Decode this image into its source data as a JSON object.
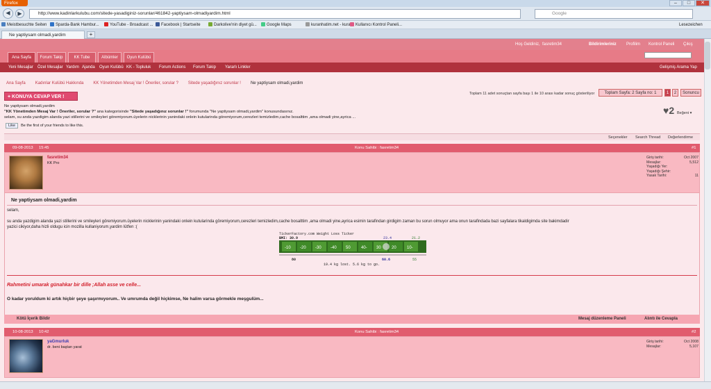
{
  "browser": {
    "app_button": "Firefox",
    "url": "http://www.kadinlarkulubu.com/sitede-yasadiginiz-sorunlar/461842-yaptiysam-olmadiyardim.html",
    "search_placeholder": "Google",
    "bookmarks_label": "Lesezeichen",
    "tab_title": "Ne yaptiysam olmadi,yardim",
    "new_tab": "+",
    "back": "◀",
    "forward": "▶",
    "min": "–",
    "max": "□",
    "close": "✕",
    "bookmarks": [
      {
        "label": "Meistbesuchte Seiten",
        "color": "#4a7fc0"
      },
      {
        "label": "Sparda-Bank Hambur...",
        "color": "#2f73c7"
      },
      {
        "label": "YouTube - Broadcast ...",
        "color": "#d22"
      },
      {
        "label": "Facebook | Startseite",
        "color": "#3b5998"
      },
      {
        "label": "Darkolive'nin diyet gü...",
        "color": "#7a3"
      },
      {
        "label": "Google Maps",
        "color": "#4c8"
      },
      {
        "label": "kuranhatim.net - kura...",
        "color": "#999"
      },
      {
        "label": "Kullanıcı Kontrol Paneli...",
        "color": "#e05a86"
      }
    ]
  },
  "site": {
    "top_links": {
      "welcome": "Hoş Geldiniz, ",
      "user": "fasretim34",
      "notifications": "Bildirimleriniz",
      "profile": "Profilim",
      "control_panel": "Kontrol Paneli",
      "logout": "Çıkış"
    },
    "main_tabs": [
      "Ana Sayfa",
      "Forum Takip",
      "KK Tube",
      "Albümler",
      "Oyun Kulübü"
    ],
    "sub_nav": [
      "Yeni Mesajlar",
      "Özel Mesajlar",
      "Yardım",
      "Ajanda",
      "Oyun Kulübü",
      "KK - Topluluk",
      "Forum Actions",
      "Forum Takip",
      "Yararlı Linkler"
    ],
    "advanced_search": "Gelişmiş Arama Yap",
    "breadcrumb": [
      "Ana Sayfa",
      "Kadınlar Kulübü Hakkında",
      "KK Yönetimden Mesaj Var ! Öneriler, sorular ?",
      "Sitede yaşadığınız sorunlar !",
      "Ne yaptiysam olmadi,yardim"
    ],
    "reply_button": "+ KONUYA CEVAP VER !",
    "page_info": "Toplam 11 adet sonuçtan sayfa başı 1 ile 10 arası kadar sonuç gösteriliyor",
    "pager": {
      "summary": "Toplam Sayfa: 2 Sayfa no: 1",
      "pages": [
        "1",
        "2"
      ],
      "last": "Sonuncu"
    },
    "intro": {
      "line1": "Ne yaptiysam olmadi,yardim",
      "cat1": "\"KK Yönetimden Mesaj Var ! Öneriler, sorular ?\"",
      "mid1": " ana kategorisinde ",
      "cat2": "\"Sitede yaşadığınız sorunlar !\"",
      "mid2": " forumunda \"Ne yaptiysam olmadi,yardim\" konusundasınız.",
      "line3": "selam, su anda yazdigim alanda yazi stillerini ve smileyleri göremiyorum.üyelerin nicklerinin yanindaki onlein kutularinda göremiyorum,cerezleri temizledim,cache bosalttim ,ama olmadi yine,ayrica ..."
    },
    "like": {
      "button": "Like",
      "text": "Be the first of your friends to like this."
    },
    "likes_count": "2",
    "likes_label": "Beğeni",
    "toolbar": [
      "Seçenekler",
      "Search Thread",
      "Değerlendirme"
    ]
  },
  "posts": [
    {
      "date": "09-08-2013",
      "time": "15:45",
      "owner": "Konu Sahibi : fasretim34",
      "num": "#1",
      "user": "fasretim34",
      "user_title": "KK Pro",
      "stats": [
        {
          "k": "Giriş tarihi:",
          "v": "Oct 2007"
        },
        {
          "k": "Mesajlar:",
          "v": "5,512"
        },
        {
          "k": "Yaşadığı Yer:",
          "v": ""
        },
        {
          "k": "Yaşadığı Şehir:",
          "v": ""
        },
        {
          "k": "Yasak Tarihi:",
          "v": "11"
        }
      ],
      "title": "Ne yaptiysam olmadi,yardim",
      "body1": "selam,",
      "body2": "su anda yazdigim alanda yazi stillerini ve smileyleri göremiyorum.üyelerin nicklerinin yanindaki onlein kutularinda göremiyorum,cerezleri temizledim,cache bosalttim ,ama olmadi yine,ayrica esimin tarafindan girdigim zaman bu sorun olmuyor ama onun tarafindada bazi sayfalara tikaldigimda site bakimdadir yazici cikiyor,daha hizli oldugu icin mozilla kullaniyorum,yardim lütfen :(",
      "ticker": {
        "brand": "TickerFactory.com Weight Loss Ticker",
        "bmi_label": "BMI: 30.9",
        "bmi_mid": "23.4",
        "bmi_end": "21.2",
        "scale": [
          "-10",
          "-20",
          "-30",
          "-40",
          "50",
          "40-",
          "30",
          "20",
          "10-"
        ],
        "start": "80",
        "current": "60.6",
        "goal": "55",
        "caption": "19.4 kg lost. 5.6 kg to go."
      },
      "sig1": "Rahmetini umarak günahkar bir dille ;Allah asse ve celle...",
      "sig2": "O kadar yoruldum ki artık hiçbir şeye şaşırmıyorum.. Ve umrumda değil hiçkimse, Ne halim varsa görmekle meşgulüm...",
      "foot": {
        "report": "Kötü İçerik Bildir",
        "edit": "Mesaj düzenleme Paneli",
        "quote": "Alıntı ile Cevapla"
      }
    },
    {
      "date": "10-08-2013",
      "time": "10:42",
      "owner": "Konu Sahibi : fasretim34",
      "num": "#2",
      "user": "yaGmurluk",
      "user_title": "dr. beni baştan yarat",
      "stats": [
        {
          "k": "Giriş tarihi:",
          "v": "Oct 2008"
        },
        {
          "k": "Mesajlar:",
          "v": "5,107"
        }
      ]
    }
  ]
}
